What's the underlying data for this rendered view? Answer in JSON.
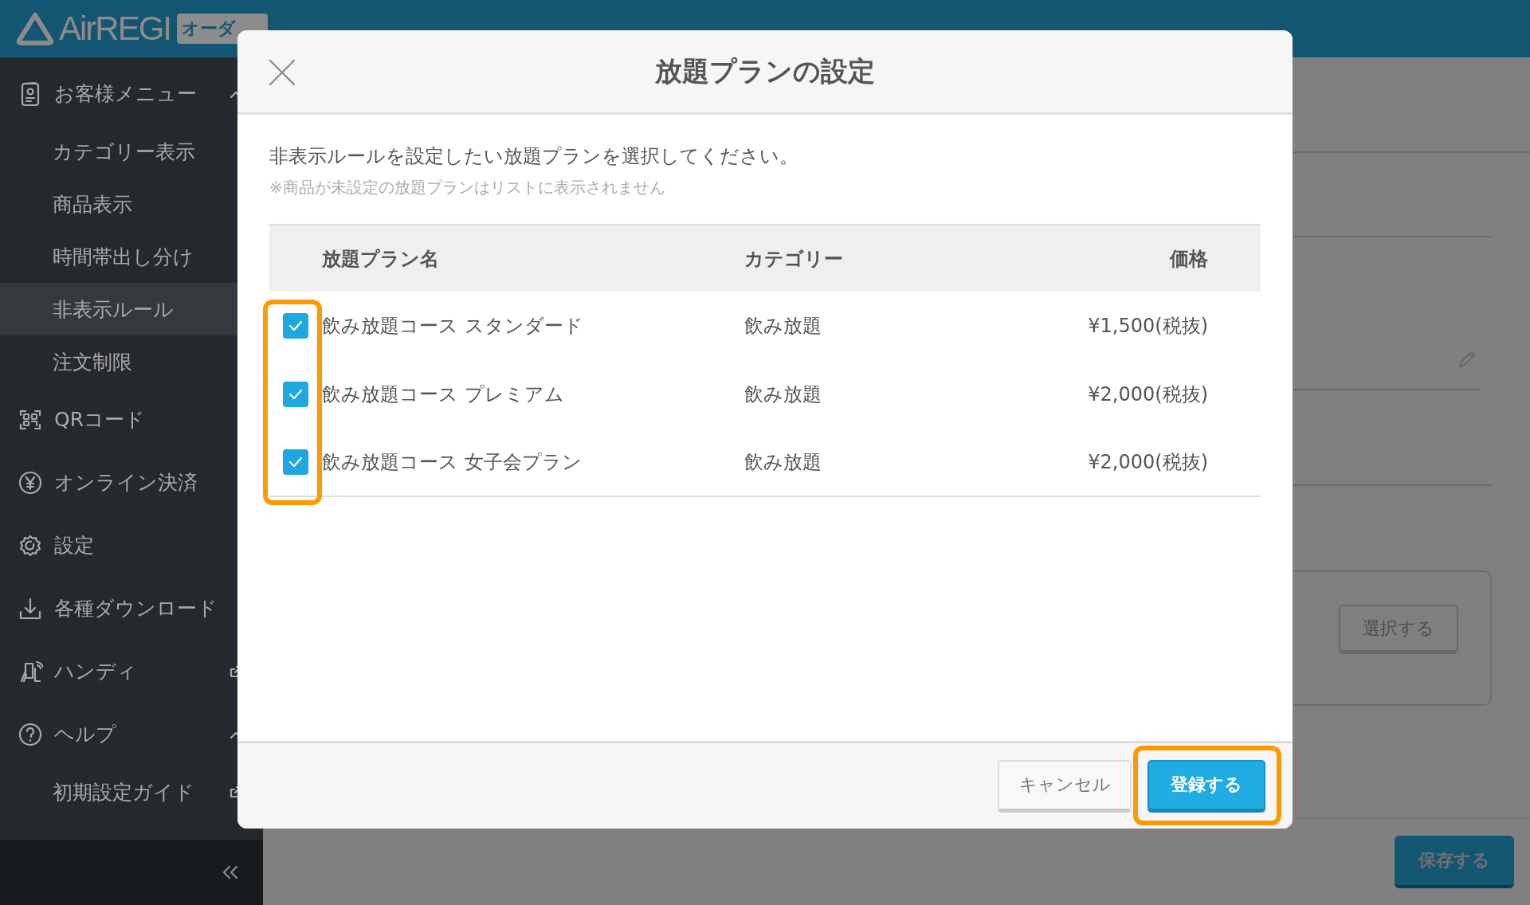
{
  "header": {
    "logo": "AirREGI",
    "badge": "オーダ"
  },
  "sidebar": {
    "items": [
      {
        "label": "お客様メニュー",
        "selected": false,
        "expanded": true,
        "children": [
          {
            "label": "カテゴリー表示",
            "selected": false
          },
          {
            "label": "商品表示",
            "selected": false
          },
          {
            "label": "時間帯出し分け",
            "selected": false
          },
          {
            "label": "非表示ルール",
            "selected": true
          },
          {
            "label": "注文制限",
            "selected": false
          }
        ]
      },
      {
        "label": "QRコード",
        "selected": false
      },
      {
        "label": "オンライン決済",
        "selected": false
      },
      {
        "label": "設定",
        "selected": false
      },
      {
        "label": "各種ダウンロード",
        "selected": false
      },
      {
        "label": "ハンディ",
        "selected": false,
        "external": true
      },
      {
        "label": "ヘルプ",
        "selected": false,
        "expanded": true,
        "children": [
          {
            "label": "初期設定ガイド",
            "selected": false,
            "external": true
          }
        ]
      }
    ]
  },
  "main": {
    "select_button": "選択する",
    "save_button": "保存する"
  },
  "modal": {
    "title": "放題プランの設定",
    "instruction": "非表示ルールを設定したい放題プランを選択してください。",
    "note": "※商品が未設定の放題プランはリストに表示されません",
    "table": {
      "columns": [
        "放題プラン名",
        "カテゴリー",
        "価格"
      ],
      "rows": [
        {
          "checked": true,
          "name": "飲み放題コース スタンダード",
          "category": "飲み放題",
          "price": "¥1,500(税抜)"
        },
        {
          "checked": true,
          "name": "飲み放題コース プレミアム",
          "category": "飲み放題",
          "price": "¥2,000(税抜)"
        },
        {
          "checked": true,
          "name": "飲み放題コース 女子会プラン",
          "category": "飲み放題",
          "price": "¥2,000(税抜)"
        }
      ]
    },
    "cancel_button": "キャンセル",
    "submit_button": "登録する"
  }
}
